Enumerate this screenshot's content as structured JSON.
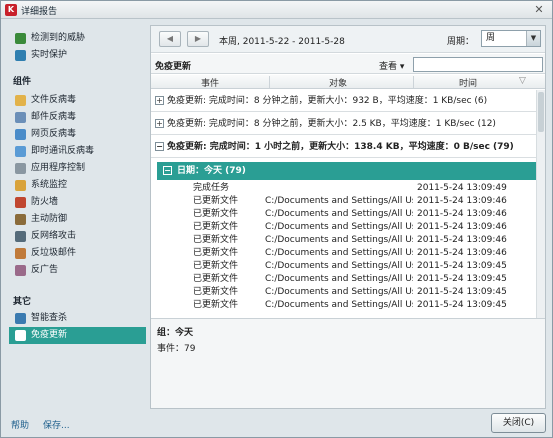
{
  "window": {
    "title": "详细报告",
    "close_glyph": "✕",
    "app_glyph": "K"
  },
  "sidebar": {
    "top_items": [
      {
        "label": "检测到的威胁",
        "icon": "shield-icon",
        "color": "#3a8a3a"
      },
      {
        "label": "实时保护",
        "icon": "shield-icon",
        "color": "#2f7fb0"
      }
    ],
    "components_header": "组件",
    "components": [
      {
        "label": "文件反病毒",
        "icon": "folder-icon",
        "color": "#e2b24a"
      },
      {
        "label": "邮件反病毒",
        "icon": "mail-icon",
        "color": "#6b8fb8"
      },
      {
        "label": "网页反病毒",
        "icon": "globe-icon",
        "color": "#4a8cc9"
      },
      {
        "label": "即时通讯反病毒",
        "icon": "chat-icon",
        "color": "#5a9bd5"
      },
      {
        "label": "应用程序控制",
        "icon": "filter-icon",
        "color": "#8a97a1"
      },
      {
        "label": "系统监控",
        "icon": "monitor-icon",
        "color": "#d9a33b"
      },
      {
        "label": "防火墙",
        "icon": "firewall-icon",
        "color": "#c0462f"
      },
      {
        "label": "主动防御",
        "icon": "shield-icon",
        "color": "#8a6b3a"
      },
      {
        "label": "反网络攻击",
        "icon": "network-icon",
        "color": "#556b7a"
      },
      {
        "label": "反垃圾邮件",
        "icon": "spam-icon",
        "color": "#c07a3a"
      },
      {
        "label": "反广告",
        "icon": "ad-icon",
        "color": "#9a6a8a"
      }
    ],
    "other_header": "其它",
    "other": [
      {
        "label": "智能查杀",
        "icon": "scan-icon",
        "color": "#3a7ab0",
        "active": false
      },
      {
        "label": "免疫更新",
        "icon": "update-icon",
        "color": "#2a9e94",
        "active": true
      }
    ]
  },
  "toolbar": {
    "back_glyph": "◀",
    "forward_glyph": "▶",
    "period_text": "本周, 2011-5-22 - 2011-5-28",
    "period_label": "周期：",
    "period_value": "周",
    "select_arrow": "▼"
  },
  "section": {
    "title": "免疫更新",
    "view_label": "查看 ▾"
  },
  "columns": {
    "event": "事件",
    "object": "对象",
    "time": "时间",
    "sort_glyph": "▽"
  },
  "groups": [
    {
      "label": "免疫更新: 完成时间：8 分钟之前，更新大小：932 B，平均速度：1 KB/sec (6)",
      "expander": "+",
      "bold": false
    },
    {
      "label": "免疫更新: 完成时间：8 分钟之前，更新大小：2.5 KB，平均速度：1 KB/sec (12)",
      "expander": "+",
      "bold": false
    },
    {
      "label": "免疫更新: 完成时间：1 小时之前，更新大小：138.4 KB，平均速度：0 B/sec (79)",
      "expander": "−",
      "bold": true
    }
  ],
  "date_group": {
    "label": "日期：今天 (79)",
    "expander": "−"
  },
  "rows": [
    {
      "event": "完成任务",
      "object": "",
      "time": "2011-5-24 13:09:49"
    },
    {
      "event": "已更新文件",
      "object": "C:/Documents and Settings/All Users/...",
      "time": "2011-5-24 13:09:46"
    },
    {
      "event": "已更新文件",
      "object": "C:/Documents and Settings/All Users/...",
      "time": "2011-5-24 13:09:46"
    },
    {
      "event": "已更新文件",
      "object": "C:/Documents and Settings/All Users/...",
      "time": "2011-5-24 13:09:46"
    },
    {
      "event": "已更新文件",
      "object": "C:/Documents and Settings/All Users/...",
      "time": "2011-5-24 13:09:46"
    },
    {
      "event": "已更新文件",
      "object": "C:/Documents and Settings/All Users/...",
      "time": "2011-5-24 13:09:46"
    },
    {
      "event": "已更新文件",
      "object": "C:/Documents and Settings/All Users/...",
      "time": "2011-5-24 13:09:45"
    },
    {
      "event": "已更新文件",
      "object": "C:/Documents and Settings/All Users/...",
      "time": "2011-5-24 13:09:45"
    },
    {
      "event": "已更新文件",
      "object": "C:/Documents and Settings/All Users/...",
      "time": "2011-5-24 13:09:45"
    },
    {
      "event": "已更新文件",
      "object": "C:/Documents and Settings/All Users/...",
      "time": "2011-5-24 13:09:45"
    }
  ],
  "details": {
    "group": "组：今天",
    "events": "事件：79"
  },
  "footer": {
    "help": "帮助",
    "save": "保存...",
    "close": "关闭(C)"
  }
}
